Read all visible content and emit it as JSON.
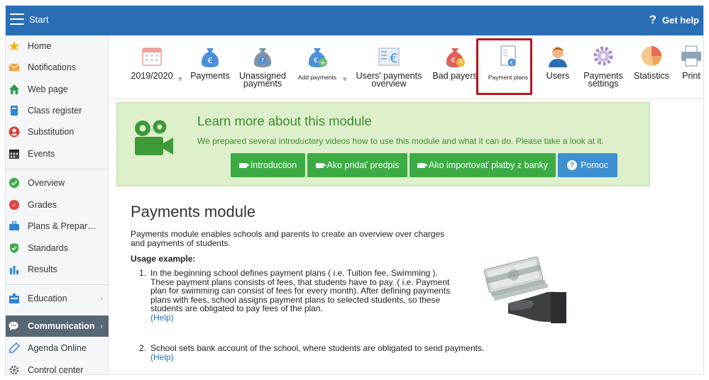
{
  "topbar": {
    "start_label": "Start",
    "help_symbol": "?",
    "help_label": "Get help",
    "bg_color": "#2a6fb6"
  },
  "sidebar": {
    "items": [
      {
        "label": "Home",
        "icon": "star-icon"
      },
      {
        "label": "Notifications",
        "icon": "envelope-icon"
      },
      {
        "label": "Web page",
        "icon": "house-icon"
      },
      {
        "label": "Class register",
        "icon": "book-icon"
      },
      {
        "label": "Substitution",
        "icon": "person-icon"
      },
      {
        "label": "Events",
        "icon": "calendar-icon"
      },
      {
        "label": "Overview",
        "icon": "check-circle-icon"
      },
      {
        "label": "Grades",
        "icon": "grades-icon"
      },
      {
        "label": "Plans & Prepar…",
        "icon": "briefcase-icon"
      },
      {
        "label": "Standards",
        "icon": "shield-icon"
      },
      {
        "label": "Results",
        "icon": "bar-chart-icon"
      },
      {
        "label": "Education",
        "icon": "education-icon"
      },
      {
        "label": "Communication",
        "icon": "chat-icon",
        "active": true
      },
      {
        "label": "Agenda Online",
        "icon": "pen-icon"
      },
      {
        "label": "Control center",
        "icon": "gear-icon"
      }
    ]
  },
  "toolbar": {
    "items": [
      {
        "label": "2019/2020",
        "icon": "calendar-icon"
      },
      {
        "label": "Payments",
        "icon": "moneybag-euro-icon"
      },
      {
        "label_line1": "Unassigned",
        "label_line2": "payments",
        "icon": "moneybag-question-icon"
      },
      {
        "label": "Add payments",
        "icon": "moneybag-add-icon"
      },
      {
        "label_line1": "Users' payments",
        "label_line2": "overview",
        "icon": "ledger-euro-icon"
      },
      {
        "label": "Bad payers",
        "icon": "moneybag-clock-icon"
      },
      {
        "label": "Payment plans",
        "icon": "document-coin-icon"
      },
      {
        "label": "Users",
        "icon": "user-icon"
      },
      {
        "label_line1": "Payments",
        "label_line2": "settings",
        "icon": "gear-icon"
      },
      {
        "label": "Statistics",
        "icon": "pie-chart-icon"
      },
      {
        "label": "Print",
        "icon": "printer-icon"
      }
    ],
    "dropdown_symbol": "▼"
  },
  "info": {
    "title": "Learn more about this module",
    "description": "We prepared several introductory videos how to use this module and what it can do. Please take a look at it.",
    "buttons": [
      "Introduction",
      "Ako pridať predpis",
      "Ako importovať platby z banky",
      "Pomoc"
    ],
    "help_symbol": "?"
  },
  "content": {
    "title": "Payments module",
    "desc_line1": "Payments module enables schools and parents to create an overview over charges",
    "desc_line2": "and payments of students.",
    "usage_label": "Usage example:",
    "item1": {
      "num": "1.",
      "line1": "In the beginning school defines payment plans ( i.e. Tuition fee, Swimming ).",
      "line2": "These payment plans consists of fees, that students have to pay. ( i.e. Payment",
      "line3": "plan for swimming can consist of fees for every month). After defining payments",
      "line4": "plans with fees, school assigns payment plans to selected students, so these",
      "line5": "students are obligated to pay fees of the plan.",
      "help": "(Help)"
    },
    "item2": {
      "num": "2.",
      "line1": "School sets bank account of the school, where students are obligated to send payments.",
      "help": "(Help)"
    }
  }
}
